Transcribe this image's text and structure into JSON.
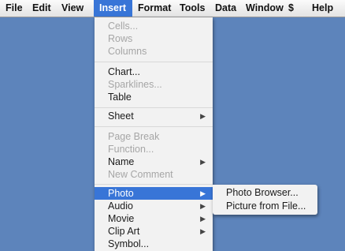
{
  "menubar": {
    "items": [
      "File",
      "Edit",
      "View",
      "Insert",
      "Format",
      "Tools",
      "Data",
      "Window",
      "$",
      "Help"
    ],
    "active_index": 3
  },
  "insert_menu": {
    "items": [
      {
        "label": "Cells...",
        "enabled": false
      },
      {
        "label": "Rows",
        "enabled": false
      },
      {
        "label": "Columns",
        "enabled": false
      },
      {
        "label": "Chart...",
        "enabled": true
      },
      {
        "label": "Sparklines...",
        "enabled": false
      },
      {
        "label": "Table",
        "enabled": true
      },
      {
        "label": "Sheet",
        "enabled": true,
        "submenu": true
      },
      {
        "label": "Page Break",
        "enabled": false
      },
      {
        "label": "Function...",
        "enabled": false
      },
      {
        "label": "Name",
        "enabled": true,
        "submenu": true
      },
      {
        "label": "New Comment",
        "enabled": false
      },
      {
        "label": "Photo",
        "enabled": true,
        "submenu": true,
        "highlighted": true
      },
      {
        "label": "Audio",
        "enabled": true,
        "submenu": true
      },
      {
        "label": "Movie",
        "enabled": true,
        "submenu": true
      },
      {
        "label": "Clip Art",
        "enabled": true,
        "submenu": true
      },
      {
        "label": "Symbol...",
        "enabled": true
      }
    ],
    "submenu_arrow": "▶"
  },
  "photo_submenu": {
    "items": [
      "Photo Browser...",
      "Picture from File..."
    ]
  },
  "colors": {
    "desktop": "#5d84bb",
    "highlight": "#3875d7",
    "menu_bg": "#f2f2f2",
    "disabled_text": "#a6a6a6"
  }
}
